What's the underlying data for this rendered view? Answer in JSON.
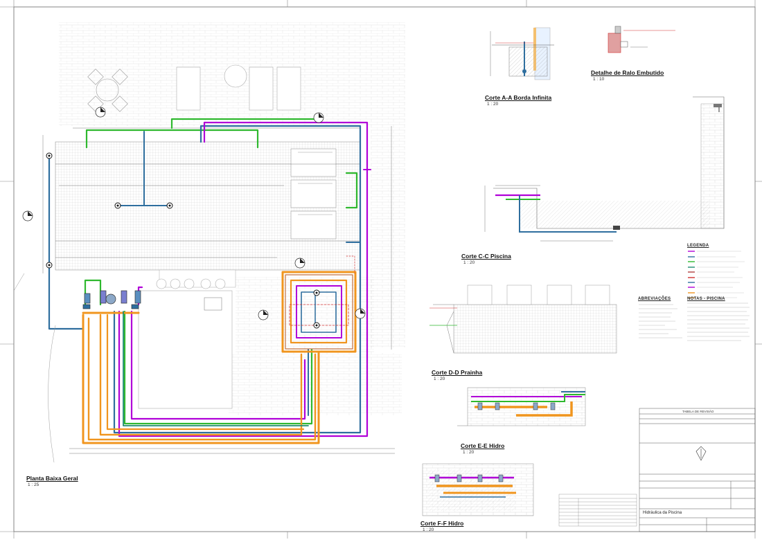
{
  "drawing": {
    "plan": {
      "title": "Planta Baixa Geral",
      "scale": "1 : 25"
    },
    "views": [
      {
        "id": "corte-aa",
        "title": "Corte A-A Borda Infinita",
        "scale": "1 : 20"
      },
      {
        "id": "ralo",
        "title": "Detalhe de Ralo Embutido",
        "scale": "1 : 10"
      },
      {
        "id": "corte-cc",
        "title": "Corte C-C Piscina",
        "scale": "1 : 20"
      },
      {
        "id": "corte-dd",
        "title": "Corte D-D Prainha",
        "scale": "1 : 20"
      },
      {
        "id": "corte-ee",
        "title": "Corte E-E Hidro",
        "scale": "1 : 20"
      },
      {
        "id": "corte-ff",
        "title": "Corte F-F Hidro",
        "scale": "1 : 20"
      }
    ],
    "legend": {
      "title": "LEGENDA"
    },
    "abbreviations": {
      "title": "ABREVIAÇÕES"
    },
    "notes": {
      "title": "NOTAS - PISCINA"
    },
    "title_block": {
      "header": "TABELA DE REVISÃO",
      "sheet_name": "Hidráulica da Piscina"
    },
    "pipe_colors": {
      "green": "#2eb82e",
      "purple": "#b000d8",
      "blue": "#2e6e9e",
      "orange": "#f0951e",
      "teal": "#1e8c70",
      "red": "#d03030"
    }
  }
}
